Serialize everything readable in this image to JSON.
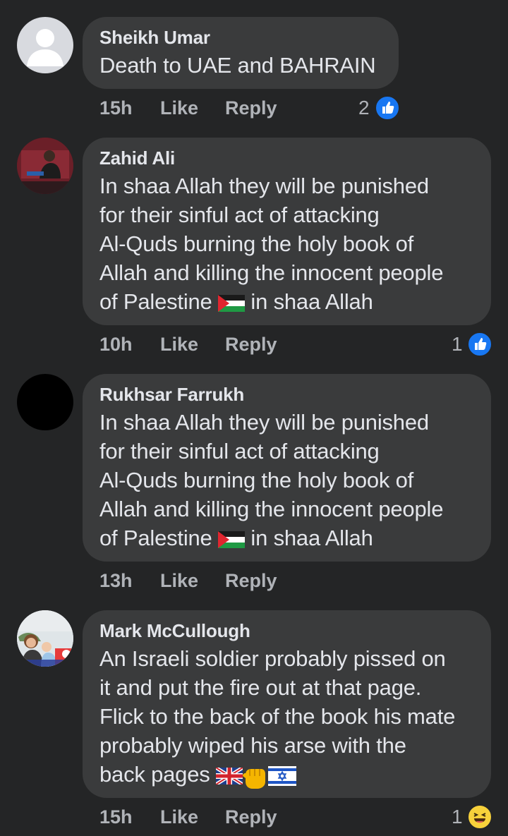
{
  "comments": [
    {
      "author": "Sheikh Umar",
      "text": "Death to UAE and BAHRAIN",
      "time": "15h",
      "like_label": "Like",
      "reply_label": "Reply",
      "reaction_count": "2",
      "reaction_icon": "like-icon"
    },
    {
      "author": "Zahid Ali",
      "text_lines": [
        "In shaa Allah they will be punished",
        "for their sinful act of attacking",
        "Al-Quds burning the holy book of",
        "Allah and killing the innocent people"
      ],
      "text_last_before": "of Palestine ",
      "text_last_after": " in shaa Allah",
      "time": "10h",
      "like_label": "Like",
      "reply_label": "Reply",
      "reaction_count": "1",
      "reaction_icon": "like-icon"
    },
    {
      "author": "Rukhsar Farrukh",
      "text_lines": [
        "In shaa Allah they will be punished",
        "for their sinful act of attacking",
        "Al-Quds burning the holy book of",
        "Allah and killing the innocent people"
      ],
      "text_last_before": "of Palestine ",
      "text_last_after": " in shaa Allah",
      "time": "13h",
      "like_label": "Like",
      "reply_label": "Reply"
    },
    {
      "author": "Mark McCullough",
      "text_lines": [
        "An Israeli soldier probably pissed on",
        "it and put the fire out at that page.",
        "Flick to the back of the book his mate",
        "probably wiped his arse with the"
      ],
      "text_last_before": "back pages ",
      "time": "15h",
      "like_label": "Like",
      "reply_label": "Reply",
      "reaction_count": "1",
      "reaction_icon": "haha-icon"
    }
  ],
  "colors": {
    "background": "#242526",
    "bubble": "#3a3b3c",
    "primary_text": "#e4e6eb",
    "secondary_text": "#b0b3b8",
    "like_blue": "#1877f2"
  }
}
